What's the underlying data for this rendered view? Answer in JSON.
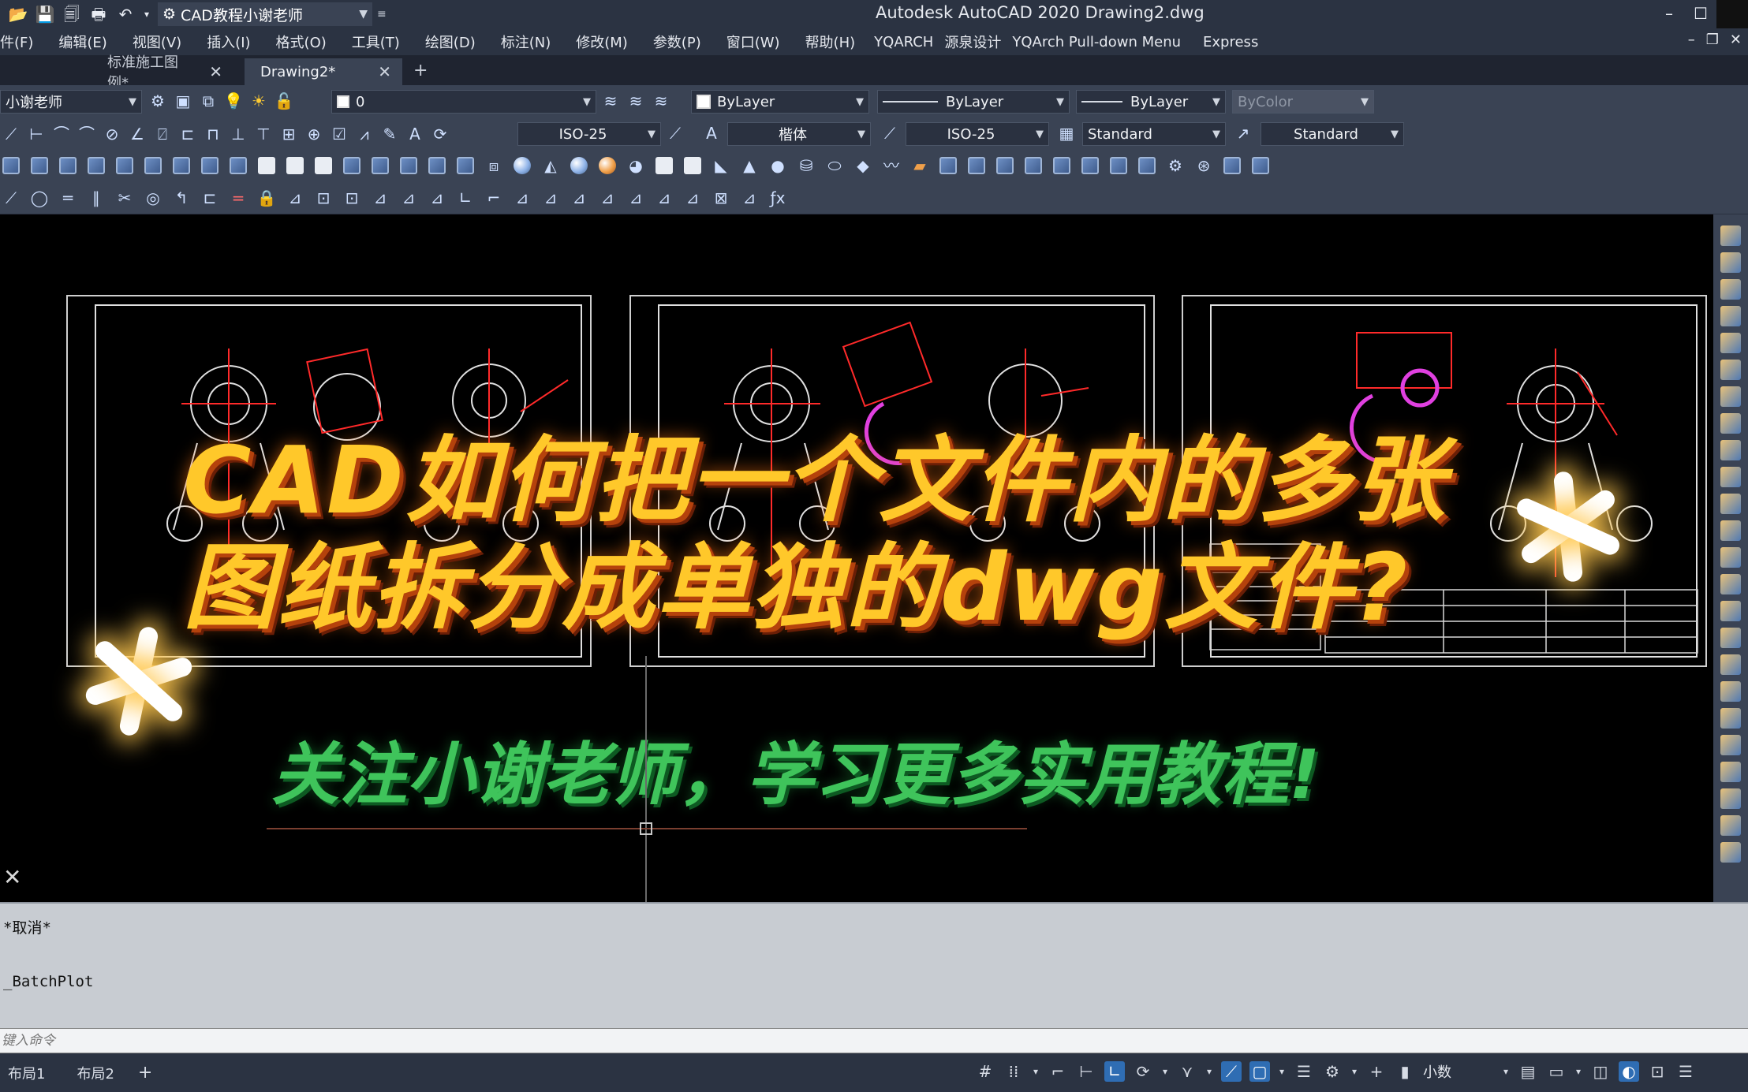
{
  "titlebar": {
    "workspace": "CAD教程小谢老师",
    "title": "Autodesk AutoCAD 2020    Drawing2.dwg"
  },
  "menu": [
    "件(F)",
    "编辑(E)",
    "视图(V)",
    "插入(I)",
    "格式(O)",
    "工具(T)",
    "绘图(D)",
    "标注(N)",
    "修改(M)",
    "参数(P)",
    "窗口(W)",
    "帮助(H)",
    "YQARCH",
    "源泉设计",
    "YQArch Pull-down Menu",
    "Express"
  ],
  "tabs": [
    {
      "label": "标准施工图例*",
      "active": false
    },
    {
      "label": "Drawing2*",
      "active": true
    }
  ],
  "toolbar": {
    "workspace_combo": "小谢老师",
    "layer_combo": "0",
    "color_combo": "ByLayer",
    "linetype_combo": "ByLayer",
    "lineweight_combo": "ByLayer",
    "plotstyle_combo": "ByColor",
    "dimstyle_combo": "ISO-25",
    "textstyle_combo": "楷体",
    "dimstyle2_combo": "ISO-25",
    "tablestyle_combo": "Standard",
    "mleader_combo": "Standard"
  },
  "overlay": {
    "headline_line1": "CAD如何把一个文件内的多张",
    "headline_line2": "图纸拆分成单独的dwg文件?",
    "subline": "关注小谢老师，学习更多实用教程!"
  },
  "command": {
    "history_line1": "*取消*",
    "history_line2": "_BatchPlot",
    "input_placeholder": "键入命令"
  },
  "status": {
    "layouts": [
      "布局1",
      "布局2"
    ],
    "units": "小数"
  },
  "colors": {
    "chrome_dark": "#2b3342",
    "chrome_mid": "#3a4354",
    "canvas": "#000000",
    "headline": "#ffc82a",
    "subline": "#3fc45b"
  }
}
